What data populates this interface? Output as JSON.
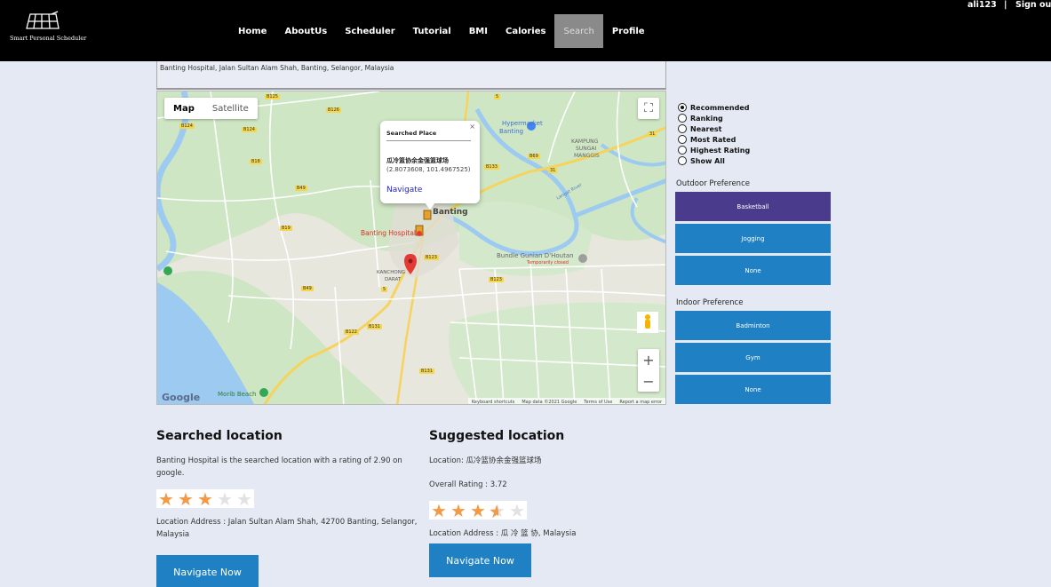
{
  "header": {
    "logo_text": "Smart Personal Scheduler",
    "nav": [
      "Home",
      "AboutUs",
      "Scheduler",
      "Tutorial",
      "BMI",
      "Calories",
      "Search",
      "Profile"
    ],
    "active_nav": "Search",
    "username": "ali123",
    "separator": "|",
    "signout": "Sign out"
  },
  "search": {
    "address": "Banting Hospital, Jalan Sultan Alam Shah, Banting, Selangor, Malaysia"
  },
  "map": {
    "type_buttons": [
      "Map",
      "Satellite"
    ],
    "selected_type": "Map",
    "popup": {
      "title": "Searched Place",
      "name": "瓜冷篮协余金强篮球场",
      "coords": "(2.8073608, 101.4967525)",
      "navigate": "Navigate",
      "close": "×"
    },
    "labels": {
      "hypermarket": "Hypermarket",
      "banting_small": "Banting",
      "kampung": "KAMPUNG",
      "sungai": "SUNGAI",
      "manggis": "MANGGIS",
      "banting_town": "Banting",
      "hospital": "Banting Hospital",
      "bundle": "Bundle Gunian D'Houtan",
      "closed": "Temporarily closed",
      "kanchong": "KANCHONG",
      "darat": "DARAT",
      "morib": "Morib Beach",
      "langat": "Langat River"
    },
    "road_labels": [
      "B125",
      "5",
      "B124",
      "B124",
      "B126",
      "B18",
      "B49",
      "31",
      "B19",
      "B69",
      "B123",
      "B133",
      "B49",
      "5",
      "B123",
      "B122",
      "B131",
      "B131",
      "31"
    ],
    "google": "Google",
    "attribution": [
      "Keyboard shortcuts",
      "Map data ©2021 Google",
      "Terms of Use",
      "Report a map error"
    ],
    "zoom_in": "+",
    "zoom_out": "−"
  },
  "filters": {
    "options": [
      "Recommended",
      "Ranking",
      "Nearest",
      "Most Rated",
      "Highest Rating",
      "Show All"
    ],
    "selected": "Recommended"
  },
  "outdoor": {
    "title": "Outdoor Preference",
    "buttons": [
      "Basketball",
      "Jogging",
      "None"
    ],
    "selected": "Basketball"
  },
  "indoor": {
    "title": "Indoor Preference",
    "buttons": [
      "Badminton",
      "Gym",
      "None"
    ]
  },
  "searched": {
    "title": "Searched location",
    "description": "Banting Hospital is the searched location with a rating of 2.90 on google.",
    "rating": 2.9,
    "address": "Location Address : Jalan Sultan Alam Shah, 42700 Banting, Selangor, Malaysia",
    "button": "Navigate Now"
  },
  "suggested": {
    "title": "Suggested location",
    "location": "Location: 瓜冷篮协余金强篮球场",
    "overall": "Overall Rating : 3.72",
    "rating": 3.72,
    "address": "Location Address : 瓜 冷 篮 协, Malaysia",
    "button": "Navigate Now"
  },
  "colors": {
    "header_bg": "#000000",
    "page_bg": "#e4e9f3",
    "button_blue": "#1f80c4",
    "button_selected": "#4a3b8c",
    "star": "#f29a46",
    "nav_active": "#8a8a8a"
  }
}
